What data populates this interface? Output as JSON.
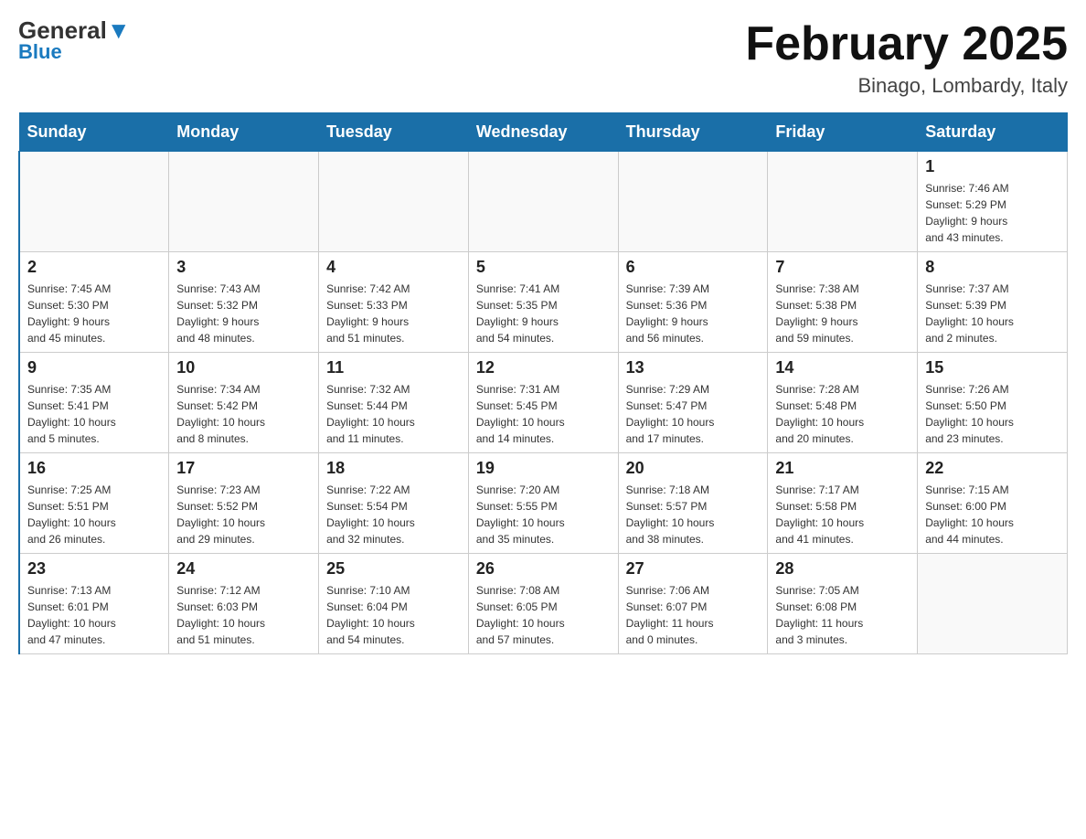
{
  "header": {
    "logo_general": "General",
    "logo_blue": "Blue",
    "month_title": "February 2025",
    "location": "Binago, Lombardy, Italy"
  },
  "days_of_week": [
    "Sunday",
    "Monday",
    "Tuesday",
    "Wednesday",
    "Thursday",
    "Friday",
    "Saturday"
  ],
  "weeks": [
    [
      {
        "day": "",
        "info": ""
      },
      {
        "day": "",
        "info": ""
      },
      {
        "day": "",
        "info": ""
      },
      {
        "day": "",
        "info": ""
      },
      {
        "day": "",
        "info": ""
      },
      {
        "day": "",
        "info": ""
      },
      {
        "day": "1",
        "info": "Sunrise: 7:46 AM\nSunset: 5:29 PM\nDaylight: 9 hours\nand 43 minutes."
      }
    ],
    [
      {
        "day": "2",
        "info": "Sunrise: 7:45 AM\nSunset: 5:30 PM\nDaylight: 9 hours\nand 45 minutes."
      },
      {
        "day": "3",
        "info": "Sunrise: 7:43 AM\nSunset: 5:32 PM\nDaylight: 9 hours\nand 48 minutes."
      },
      {
        "day": "4",
        "info": "Sunrise: 7:42 AM\nSunset: 5:33 PM\nDaylight: 9 hours\nand 51 minutes."
      },
      {
        "day": "5",
        "info": "Sunrise: 7:41 AM\nSunset: 5:35 PM\nDaylight: 9 hours\nand 54 minutes."
      },
      {
        "day": "6",
        "info": "Sunrise: 7:39 AM\nSunset: 5:36 PM\nDaylight: 9 hours\nand 56 minutes."
      },
      {
        "day": "7",
        "info": "Sunrise: 7:38 AM\nSunset: 5:38 PM\nDaylight: 9 hours\nand 59 minutes."
      },
      {
        "day": "8",
        "info": "Sunrise: 7:37 AM\nSunset: 5:39 PM\nDaylight: 10 hours\nand 2 minutes."
      }
    ],
    [
      {
        "day": "9",
        "info": "Sunrise: 7:35 AM\nSunset: 5:41 PM\nDaylight: 10 hours\nand 5 minutes."
      },
      {
        "day": "10",
        "info": "Sunrise: 7:34 AM\nSunset: 5:42 PM\nDaylight: 10 hours\nand 8 minutes."
      },
      {
        "day": "11",
        "info": "Sunrise: 7:32 AM\nSunset: 5:44 PM\nDaylight: 10 hours\nand 11 minutes."
      },
      {
        "day": "12",
        "info": "Sunrise: 7:31 AM\nSunset: 5:45 PM\nDaylight: 10 hours\nand 14 minutes."
      },
      {
        "day": "13",
        "info": "Sunrise: 7:29 AM\nSunset: 5:47 PM\nDaylight: 10 hours\nand 17 minutes."
      },
      {
        "day": "14",
        "info": "Sunrise: 7:28 AM\nSunset: 5:48 PM\nDaylight: 10 hours\nand 20 minutes."
      },
      {
        "day": "15",
        "info": "Sunrise: 7:26 AM\nSunset: 5:50 PM\nDaylight: 10 hours\nand 23 minutes."
      }
    ],
    [
      {
        "day": "16",
        "info": "Sunrise: 7:25 AM\nSunset: 5:51 PM\nDaylight: 10 hours\nand 26 minutes."
      },
      {
        "day": "17",
        "info": "Sunrise: 7:23 AM\nSunset: 5:52 PM\nDaylight: 10 hours\nand 29 minutes."
      },
      {
        "day": "18",
        "info": "Sunrise: 7:22 AM\nSunset: 5:54 PM\nDaylight: 10 hours\nand 32 minutes."
      },
      {
        "day": "19",
        "info": "Sunrise: 7:20 AM\nSunset: 5:55 PM\nDaylight: 10 hours\nand 35 minutes."
      },
      {
        "day": "20",
        "info": "Sunrise: 7:18 AM\nSunset: 5:57 PM\nDaylight: 10 hours\nand 38 minutes."
      },
      {
        "day": "21",
        "info": "Sunrise: 7:17 AM\nSunset: 5:58 PM\nDaylight: 10 hours\nand 41 minutes."
      },
      {
        "day": "22",
        "info": "Sunrise: 7:15 AM\nSunset: 6:00 PM\nDaylight: 10 hours\nand 44 minutes."
      }
    ],
    [
      {
        "day": "23",
        "info": "Sunrise: 7:13 AM\nSunset: 6:01 PM\nDaylight: 10 hours\nand 47 minutes."
      },
      {
        "day": "24",
        "info": "Sunrise: 7:12 AM\nSunset: 6:03 PM\nDaylight: 10 hours\nand 51 minutes."
      },
      {
        "day": "25",
        "info": "Sunrise: 7:10 AM\nSunset: 6:04 PM\nDaylight: 10 hours\nand 54 minutes."
      },
      {
        "day": "26",
        "info": "Sunrise: 7:08 AM\nSunset: 6:05 PM\nDaylight: 10 hours\nand 57 minutes."
      },
      {
        "day": "27",
        "info": "Sunrise: 7:06 AM\nSunset: 6:07 PM\nDaylight: 11 hours\nand 0 minutes."
      },
      {
        "day": "28",
        "info": "Sunrise: 7:05 AM\nSunset: 6:08 PM\nDaylight: 11 hours\nand 3 minutes."
      },
      {
        "day": "",
        "info": ""
      }
    ]
  ]
}
